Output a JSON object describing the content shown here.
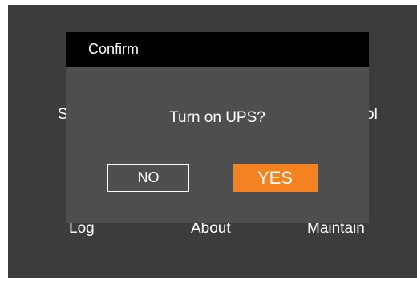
{
  "background": {
    "partial_left": "S",
    "partial_right": "ol",
    "menu": {
      "log": "Log",
      "about": "About",
      "maintain": "Maintain"
    }
  },
  "dialog": {
    "title": "Confirm",
    "message": "Turn on UPS?",
    "no_label": "NO",
    "yes_label": "YES"
  },
  "colors": {
    "screen_background": "#3c3c3c",
    "dialog_background": "#4e4e4e",
    "titlebar_background": "#000000",
    "yes_accent": "#f58220",
    "text": "#ffffff"
  }
}
